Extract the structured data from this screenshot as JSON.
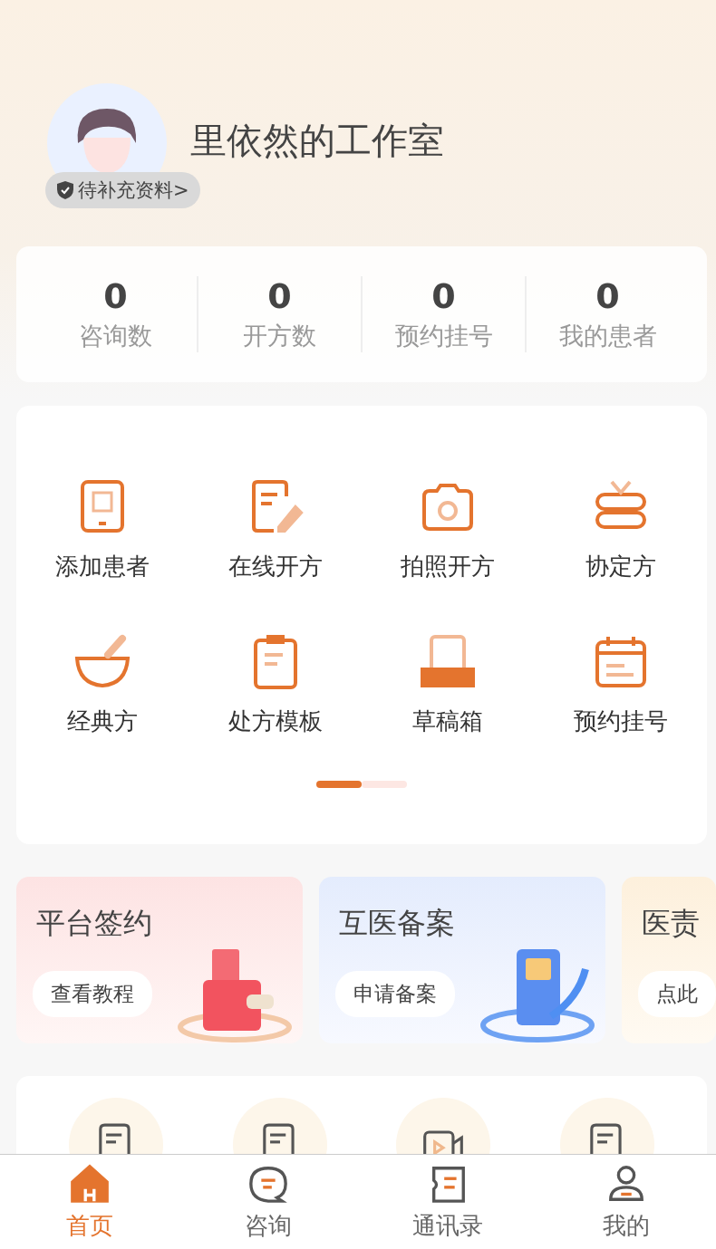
{
  "profile": {
    "name": "里依然的工作室",
    "badge": "待补充资料>"
  },
  "stats": [
    {
      "value": "0",
      "label": "咨询数"
    },
    {
      "value": "0",
      "label": "开方数"
    },
    {
      "value": "0",
      "label": "预约挂号"
    },
    {
      "value": "0",
      "label": "我的患者"
    }
  ],
  "tools": [
    {
      "kind": "tablet",
      "label": "添加患者"
    },
    {
      "kind": "edit",
      "label": "在线开方"
    },
    {
      "kind": "camera",
      "label": "拍照开方"
    },
    {
      "kind": "gift",
      "label": "协定方"
    },
    {
      "kind": "bowl",
      "label": "经典方"
    },
    {
      "kind": "clipboard",
      "label": "处方模板"
    },
    {
      "kind": "tray",
      "label": "草稿箱"
    },
    {
      "kind": "calendar",
      "label": "预约挂号"
    }
  ],
  "pager": [
    {
      "selected": true
    },
    {
      "selected": false
    }
  ],
  "promos": [
    {
      "kind": "wallet",
      "title": "平台签约",
      "button": "查看教程"
    },
    {
      "kind": "phone",
      "title": "互医备案",
      "button": "申请备案"
    },
    {
      "kind": "plain",
      "title": "医责",
      "button": "点此"
    }
  ],
  "shortcuts": [
    {
      "kind": "doc"
    },
    {
      "kind": "doc"
    },
    {
      "kind": "video"
    },
    {
      "kind": "doc"
    }
  ],
  "tabs": [
    {
      "kind": "home",
      "label": "首页",
      "selected": true
    },
    {
      "kind": "chat",
      "label": "咨询",
      "selected": false
    },
    {
      "kind": "contacts",
      "label": "通讯录",
      "selected": false
    },
    {
      "kind": "user",
      "label": "我的",
      "selected": false
    }
  ]
}
